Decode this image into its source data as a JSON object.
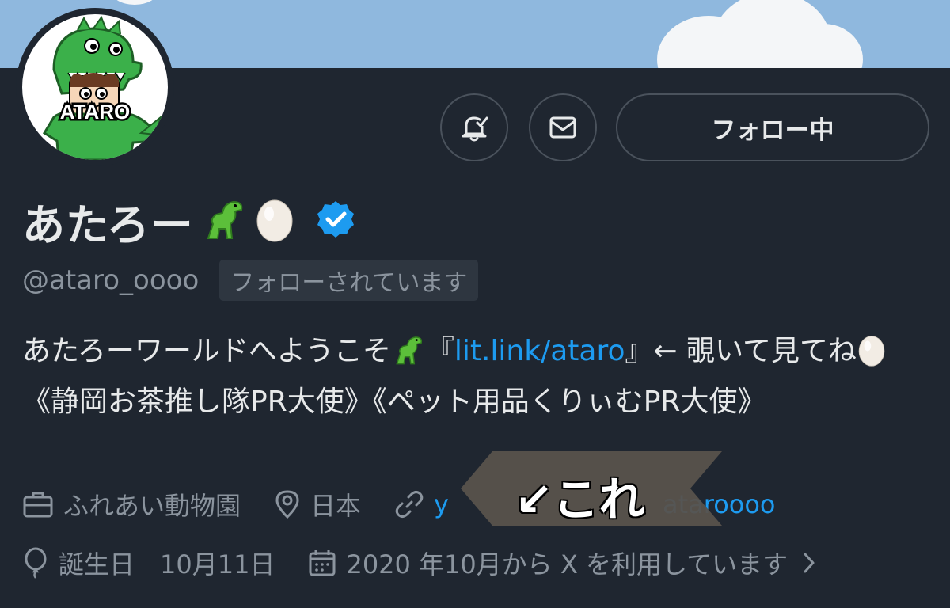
{
  "header": {
    "notify_icon": "bell-check-icon",
    "message_icon": "envelope-icon",
    "follow_label": "フォロー中"
  },
  "profile": {
    "avatar_text": "ATARO",
    "display_name": "あたろー",
    "verified": true,
    "handle": "@ataro_oooo",
    "follows_you": "フォローされています"
  },
  "bio": {
    "line_intro": "あたろーワールドへようこそ",
    "bracket_open": "『",
    "link": "lit.link/ataro",
    "bracket_close_rest": "』← 覗いて見てね",
    "rest": "《静岡お茶推し隊PR大使》《ペット用品くりぃむPR大使》"
  },
  "meta": {
    "job": "ふれあい動物園",
    "location": "日本",
    "website_start": "y",
    "website_end": "ataroooo",
    "birthday": "誕生日　10月11日",
    "joined": "2020 年10月から X を利用しています"
  },
  "annotation": {
    "text": "↙これ"
  },
  "colors": {
    "background": "#1f2630",
    "link": "#1d9bf0",
    "muted": "#8b949e",
    "verified": "#1d9bf0"
  }
}
